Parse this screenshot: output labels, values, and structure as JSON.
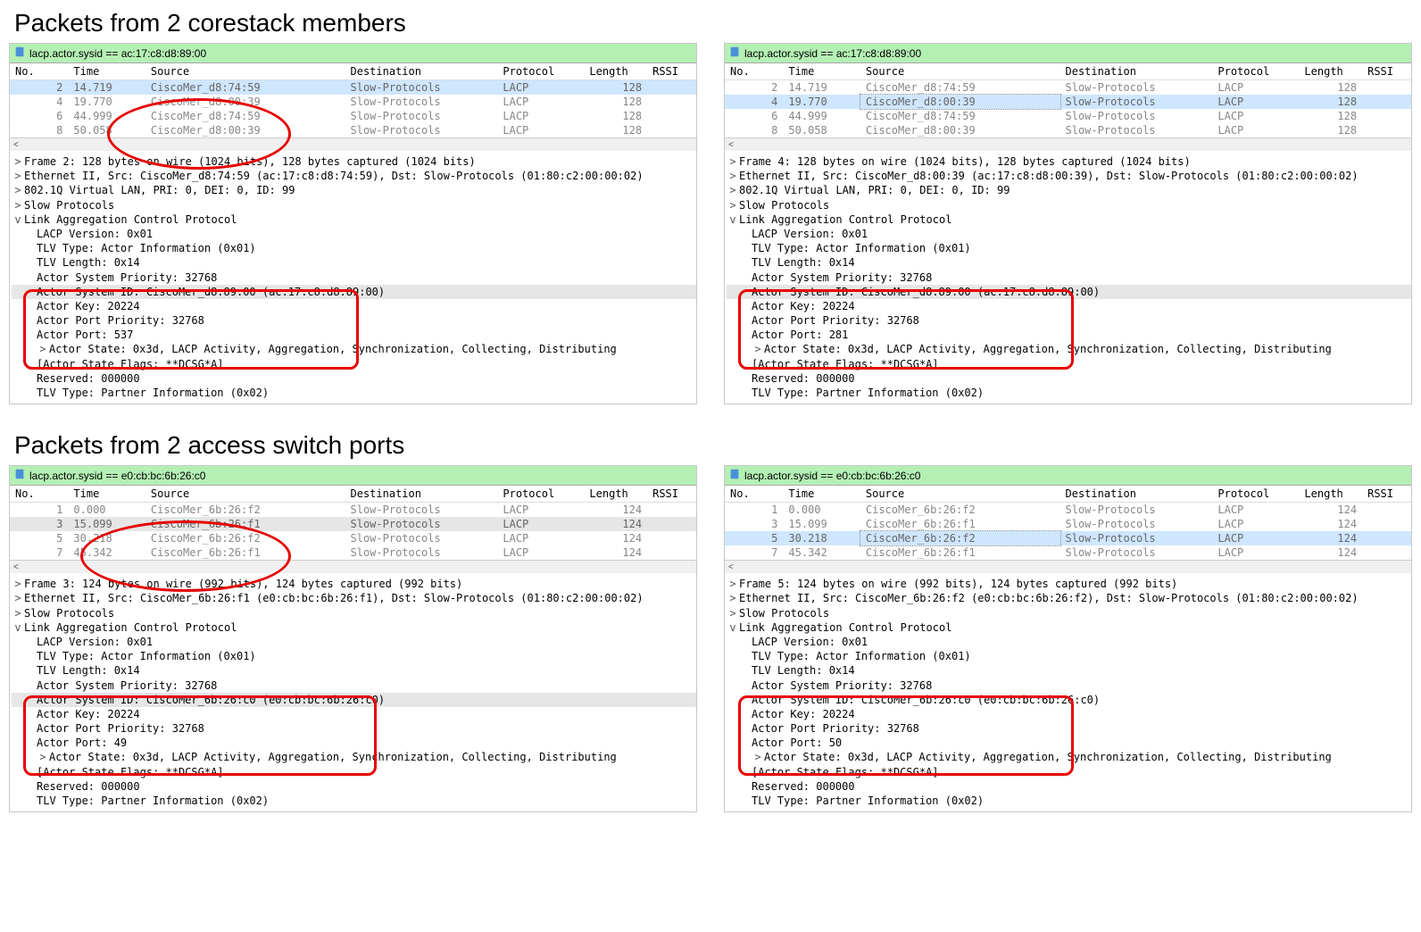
{
  "sections": [
    {
      "title": "Packets from 2 corestack members"
    },
    {
      "title": "Packets from 2 access switch ports"
    }
  ],
  "filter1": "lacp.actor.sysid == ac:17:c8:d8:89:00",
  "filter2": "lacp.actor.sysid == e0:cb:bc:6b:26:c0",
  "headers": {
    "no": "No.",
    "time": "Time",
    "src": "Source",
    "dst": "Destination",
    "proto": "Protocol",
    "len": "Length",
    "rssi": "RSSI"
  },
  "top_packets": [
    {
      "no": "2",
      "time": "14.719",
      "src": "CiscoMer_d8:74:59",
      "dst": "Slow-Protocols",
      "proto": "LACP",
      "len": "128"
    },
    {
      "no": "4",
      "time": "19.770",
      "src": "CiscoMer_d8:00:39",
      "dst": "Slow-Protocols",
      "proto": "LACP",
      "len": "128"
    },
    {
      "no": "6",
      "time": "44.999",
      "src": "CiscoMer_d8:74:59",
      "dst": "Slow-Protocols",
      "proto": "LACP",
      "len": "128"
    },
    {
      "no": "8",
      "time": "50.058",
      "src": "CiscoMer_d8:00:39",
      "dst": "Slow-Protocols",
      "proto": "LACP",
      "len": "128"
    }
  ],
  "bot_packets": [
    {
      "no": "1",
      "time": "0.000",
      "src": "CiscoMer_6b:26:f2",
      "dst": "Slow-Protocols",
      "proto": "LACP",
      "len": "124"
    },
    {
      "no": "3",
      "time": "15.099",
      "src": "CiscoMer_6b:26:f1",
      "dst": "Slow-Protocols",
      "proto": "LACP",
      "len": "124"
    },
    {
      "no": "5",
      "time": "30.218",
      "src": "CiscoMer_6b:26:f2",
      "dst": "Slow-Protocols",
      "proto": "LACP",
      "len": "124"
    },
    {
      "no": "7",
      "time": "45.342",
      "src": "CiscoMer_6b:26:f1",
      "dst": "Slow-Protocols",
      "proto": "LACP",
      "len": "124"
    }
  ],
  "d_tl": {
    "frame": "Frame 2: 128 bytes on wire (1024 bits), 128 bytes captured (1024 bits)",
    "eth": "Ethernet II, Src: CiscoMer_d8:74:59 (ac:17:c8:d8:74:59), Dst: Slow-Protocols (01:80:c2:00:00:02)",
    "vlan": "802.1Q Virtual LAN, PRI: 0, DEI: 0, ID: 99",
    "slow": "Slow Protocols",
    "lacp": "Link Aggregation Control Protocol",
    "ver": "LACP Version: 0x01",
    "tlvt": "TLV Type: Actor Information (0x01)",
    "tlvl": "TLV Length: 0x14",
    "pri": "Actor System Priority: 32768",
    "sysid": "Actor System ID: CiscoMer_d8:89:00 (ac:17:c8:d8:89:00)",
    "key": "Actor Key: 20224",
    "pp": "Actor Port Priority: 32768",
    "port": "Actor Port: 537",
    "state": "Actor State: 0x3d, LACP Activity, Aggregation, Synchronization, Collecting, Distributing",
    "flags": "[Actor State Flags: **DCSG*A]",
    "res": "Reserved: 000000",
    "part": "TLV Type: Partner Information (0x02)"
  },
  "d_tr": {
    "frame": "Frame 4: 128 bytes on wire (1024 bits), 128 bytes captured (1024 bits)",
    "eth": "Ethernet II, Src: CiscoMer_d8:00:39 (ac:17:c8:d8:00:39), Dst: Slow-Protocols (01:80:c2:00:00:02)",
    "vlan": "802.1Q Virtual LAN, PRI: 0, DEI: 0, ID: 99",
    "slow": "Slow Protocols",
    "lacp": "Link Aggregation Control Protocol",
    "ver": "LACP Version: 0x01",
    "tlvt": "TLV Type: Actor Information (0x01)",
    "tlvl": "TLV Length: 0x14",
    "pri": "Actor System Priority: 32768",
    "sysid": "Actor System ID: CiscoMer_d8:89:00 (ac:17:c8:d8:89:00)",
    "key": "Actor Key: 20224",
    "pp": "Actor Port Priority: 32768",
    "port": "Actor Port: 281",
    "state": "Actor State: 0x3d, LACP Activity, Aggregation, Synchronization, Collecting, Distributing",
    "flags": "[Actor State Flags: **DCSG*A]",
    "res": "Reserved: 000000",
    "part": "TLV Type: Partner Information (0x02)"
  },
  "d_bl": {
    "frame": "Frame 3: 124 bytes on wire (992 bits), 124 bytes captured (992 bits)",
    "eth": "Ethernet II, Src: CiscoMer_6b:26:f1 (e0:cb:bc:6b:26:f1), Dst: Slow-Protocols (01:80:c2:00:00:02)",
    "slow": "Slow Protocols",
    "lacp": "Link Aggregation Control Protocol",
    "ver": "LACP Version: 0x01",
    "tlvt": "TLV Type: Actor Information (0x01)",
    "tlvl": "TLV Length: 0x14",
    "pri": "Actor System Priority: 32768",
    "sysid": "Actor System ID: CiscoMer_6b:26:c0 (e0:cb:bc:6b:26:c0)",
    "key": "Actor Key: 20224",
    "pp": "Actor Port Priority: 32768",
    "port": "Actor Port: 49",
    "state": "Actor State: 0x3d, LACP Activity, Aggregation, Synchronization, Collecting, Distributing",
    "flags": "[Actor State Flags: **DCSG*A]",
    "res": "Reserved: 000000",
    "part": "TLV Type: Partner Information (0x02)"
  },
  "d_br": {
    "frame": "Frame 5: 124 bytes on wire (992 bits), 124 bytes captured (992 bits)",
    "eth": "Ethernet II, Src: CiscoMer_6b:26:f2 (e0:cb:bc:6b:26:f2), Dst: Slow-Protocols (01:80:c2:00:00:02)",
    "slow": "Slow Protocols",
    "lacp": "Link Aggregation Control Protocol",
    "ver": "LACP Version: 0x01",
    "tlvt": "TLV Type: Actor Information (0x01)",
    "tlvl": "TLV Length: 0x14",
    "pri": "Actor System Priority: 32768",
    "sysid": "Actor System ID: CiscoMer_6b:26:c0 (e0:cb:bc:6b:26:c0)",
    "key": "Actor Key: 20224",
    "pp": "Actor Port Priority: 32768",
    "port": "Actor Port: 50",
    "state": "Actor State: 0x3d, LACP Activity, Aggregation, Synchronization, Collecting, Distributing",
    "flags": "[Actor State Flags: **DCSG*A]",
    "res": "Reserved: 000000",
    "part": "TLV Type: Partner Information (0x02)"
  }
}
